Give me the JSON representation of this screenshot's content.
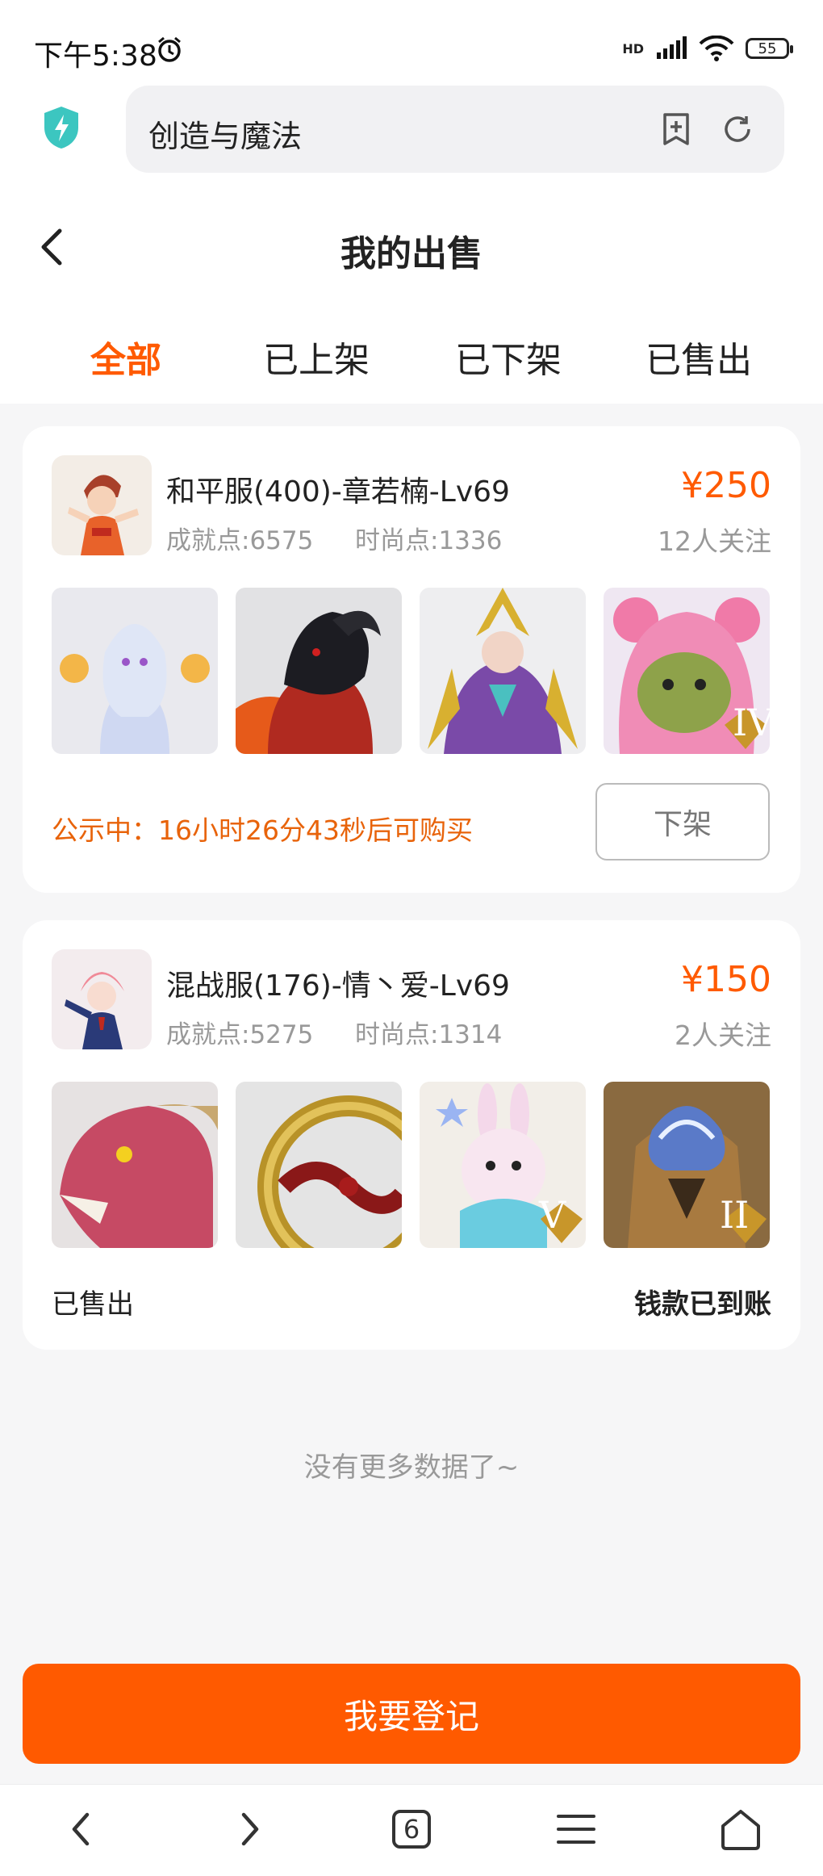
{
  "status_bar": {
    "time": "下午5:38",
    "network": "HD",
    "battery": "55"
  },
  "browser": {
    "url_text": "创造与魔法"
  },
  "page": {
    "title": "我的出售",
    "tabs": [
      {
        "label": "全部",
        "active": true
      },
      {
        "label": "已上架",
        "active": false
      },
      {
        "label": "已下架",
        "active": false
      },
      {
        "label": "已售出",
        "active": false
      }
    ]
  },
  "listings": [
    {
      "name": "和平服(400)-章若楠-Lv69",
      "achievement": "成就点:6575",
      "fashion": "时尚点:1336",
      "price": "¥250",
      "watchers": "12人关注",
      "thumbs": [
        {
          "name": "white-spirit-pet",
          "badge": ""
        },
        {
          "name": "black-ram-mount",
          "badge": ""
        },
        {
          "name": "golden-armored-heroine",
          "badge": ""
        },
        {
          "name": "pink-bear-costume",
          "badge": "IV"
        }
      ],
      "notice": "公示中：16小时26分43秒后可购买",
      "action_label": "下架"
    },
    {
      "name": "混战服(176)-情丶爱-Lv69",
      "achievement": "成就点:5275",
      "fashion": "时尚点:1314",
      "price": "¥150",
      "watchers": "2人关注",
      "thumbs": [
        {
          "name": "red-dragon-head",
          "badge": ""
        },
        {
          "name": "golden-ring-ornament",
          "badge": ""
        },
        {
          "name": "pink-bunny-pet",
          "badge": "V"
        },
        {
          "name": "armored-wolf-mount",
          "badge": "II"
        }
      ],
      "status": "已售出",
      "payment": "钱款已到账"
    }
  ],
  "footer": {
    "no_more": "没有更多数据了~",
    "register_button": "我要登记"
  },
  "bottom_nav": {
    "tab_count": "6"
  },
  "colors": {
    "accent": "#ff5a00",
    "notice": "#e8630a",
    "shield": "#3cc6c0"
  }
}
